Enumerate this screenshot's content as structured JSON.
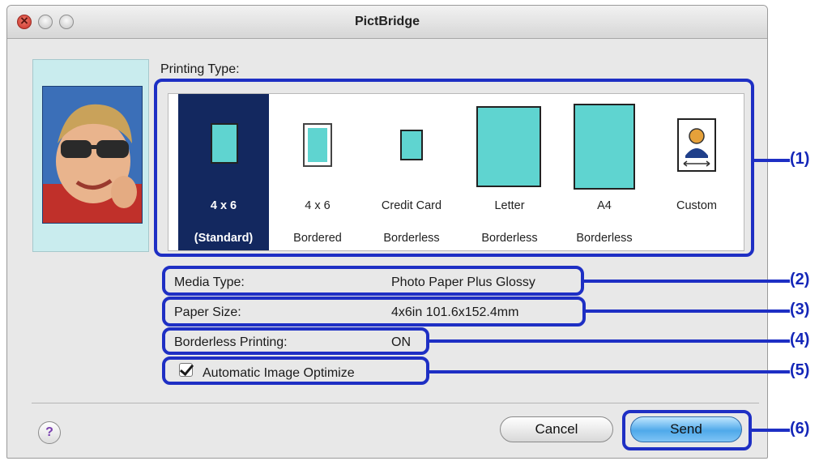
{
  "window": {
    "title": "PictBridge"
  },
  "printing_type": {
    "label": "Printing Type:",
    "options": [
      {
        "line1": "4 x 6",
        "line2": "(Standard)",
        "selected": true
      },
      {
        "line1": "4 x 6",
        "line2": "Bordered",
        "selected": false
      },
      {
        "line1": "Credit Card",
        "line2": "Borderless",
        "selected": false
      },
      {
        "line1": "Letter",
        "line2": "Borderless",
        "selected": false
      },
      {
        "line1": "A4",
        "line2": "Borderless",
        "selected": false
      },
      {
        "line1": "Custom",
        "line2": "",
        "selected": false
      }
    ]
  },
  "settings": {
    "media_type": {
      "label": "Media Type:",
      "value": "Photo Paper Plus Glossy"
    },
    "paper_size": {
      "label": "Paper Size:",
      "value": "4x6in 101.6x152.4mm"
    },
    "borderless": {
      "label": "Borderless Printing:",
      "value": "ON"
    },
    "auto_optimize": {
      "label": "Automatic Image Optimize",
      "checked": true
    }
  },
  "buttons": {
    "help": "?",
    "cancel": "Cancel",
    "send": "Send"
  },
  "callouts": [
    "(1)",
    "(2)",
    "(3)",
    "(4)",
    "(5)",
    "(6)"
  ],
  "colors": {
    "callout": "#1e2fc4",
    "selected_bg": "#13285f",
    "sheet": "#5fd4d0"
  }
}
